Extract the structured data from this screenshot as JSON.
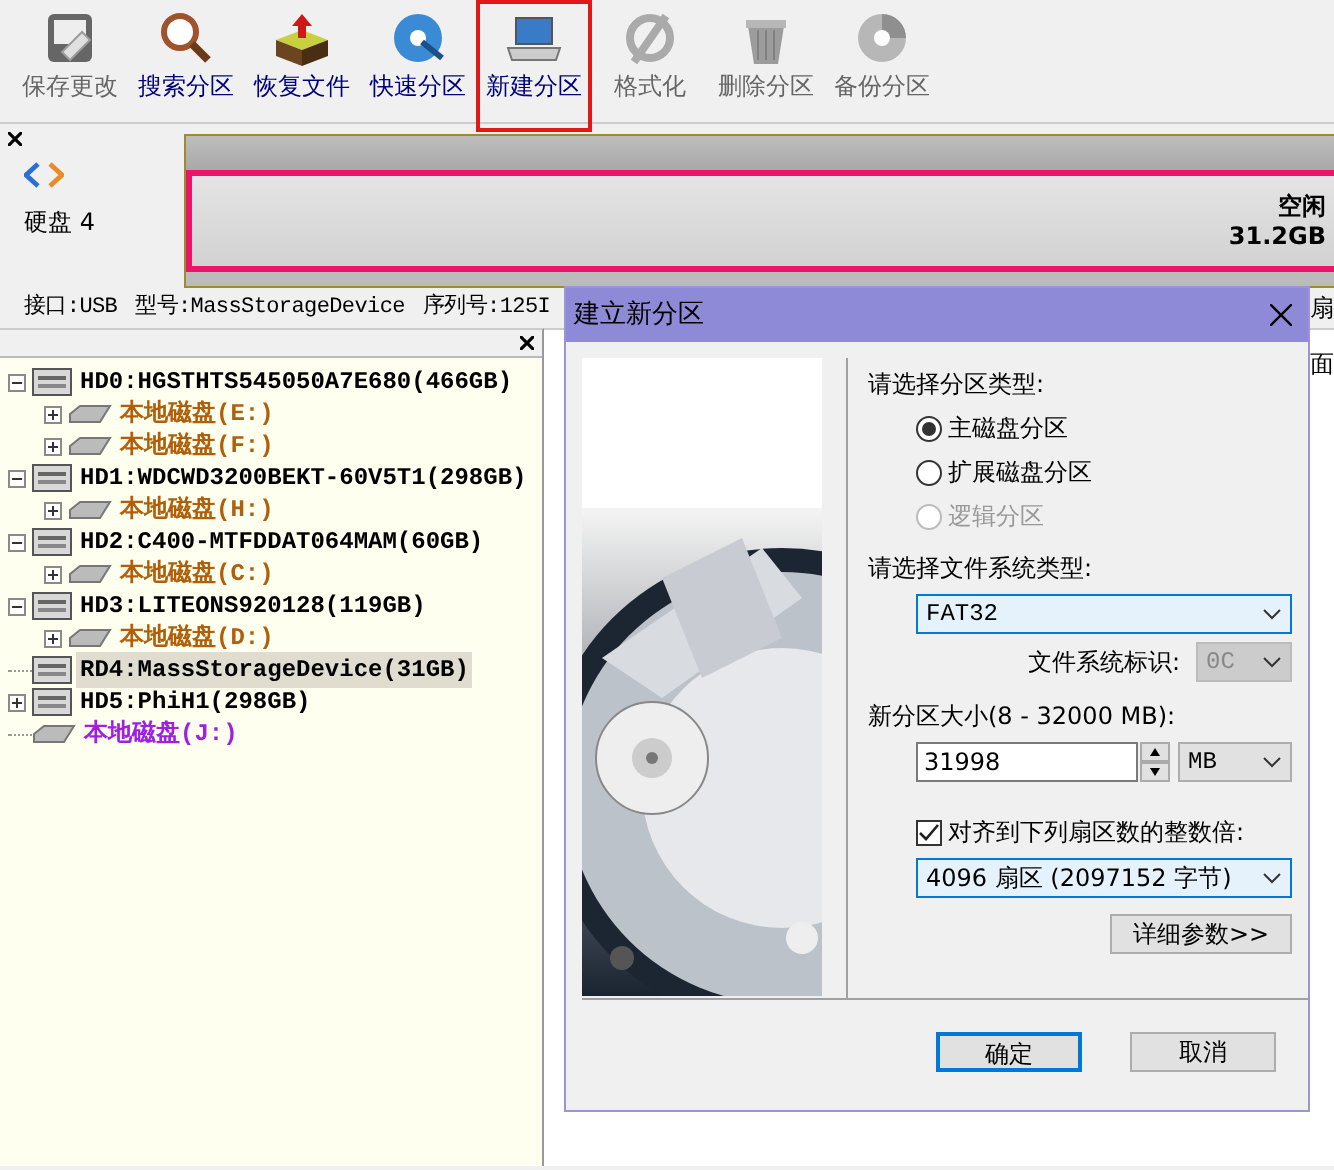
{
  "toolbar": [
    {
      "label": "保存更改",
      "disabled": true,
      "selected": false
    },
    {
      "label": "搜索分区",
      "disabled": false,
      "selected": false
    },
    {
      "label": "恢复文件",
      "disabled": false,
      "selected": false
    },
    {
      "label": "快速分区",
      "disabled": false,
      "selected": false
    },
    {
      "label": "新建分区",
      "disabled": false,
      "selected": true
    },
    {
      "label": "格式化",
      "disabled": true,
      "selected": false
    },
    {
      "label": "删除分区",
      "disabled": true,
      "selected": false
    },
    {
      "label": "备份分区",
      "disabled": true,
      "selected": false
    }
  ],
  "disk_panel": {
    "disk_label": "硬盘 4",
    "free_label": "空闲",
    "free_size": "31.2GB"
  },
  "info_bar": [
    "接口:USB",
    "型号:MassStorageDevice",
    "序列号:125I"
  ],
  "background_texts": [
    "扇",
    "面"
  ],
  "tree": [
    {
      "kind": "disk",
      "label": "HD0:HGSTHTS545050A7E680(466GB)",
      "expanded": true,
      "selected": false,
      "children": [
        {
          "kind": "partition",
          "label": "本地磁盘(E:)",
          "color": "#b0600c",
          "expanded": false,
          "selected": false
        },
        {
          "kind": "partition",
          "label": "本地磁盘(F:)",
          "color": "#b0600c",
          "expanded": false,
          "selected": false
        }
      ]
    },
    {
      "kind": "disk",
      "label": "HD1:WDCWD3200BEKT-60V5T1(298GB)",
      "expanded": true,
      "selected": false,
      "children": [
        {
          "kind": "partition",
          "label": "本地磁盘(H:)",
          "color": "#b0600c",
          "expanded": false,
          "selected": false
        }
      ]
    },
    {
      "kind": "disk",
      "label": "HD2:C400-MTFDDAT064MAM(60GB)",
      "expanded": true,
      "selected": false,
      "children": [
        {
          "kind": "partition",
          "label": "本地磁盘(C:)",
          "color": "#b0600c",
          "expanded": false,
          "selected": false
        }
      ]
    },
    {
      "kind": "disk",
      "label": "HD3:LITEONS920128(119GB)",
      "expanded": true,
      "selected": false,
      "children": [
        {
          "kind": "partition",
          "label": "本地磁盘(D:)",
          "color": "#b0600c",
          "expanded": false,
          "selected": false
        }
      ]
    },
    {
      "kind": "disk",
      "label": "RD4:MassStorageDevice(31GB)",
      "selected": true
    },
    {
      "kind": "disk",
      "label": "HD5:PhiH1(298GB)",
      "expanded": false,
      "selected": false
    },
    {
      "kind": "partition",
      "label": "本地磁盘(J:)",
      "color": "#a020e0",
      "selected": false
    }
  ],
  "dialog": {
    "title": "建立新分区",
    "partition_type_label": "请选择分区类型:",
    "partition_types": [
      {
        "label": "主磁盘分区",
        "selected": true,
        "disabled": false
      },
      {
        "label": "扩展磁盘分区",
        "selected": false,
        "disabled": false
      },
      {
        "label": "逻辑分区",
        "selected": false,
        "disabled": true
      }
    ],
    "fs_label": "请选择文件系统类型:",
    "fs_value": "FAT32",
    "fs_id_label": "文件系统标识:",
    "fs_id_value": "0C",
    "fs_id_disabled": true,
    "size_label": "新分区大小(8 - 32000 MB):",
    "size_value": "31998",
    "size_unit": "MB",
    "align_checked": true,
    "align_label": "对齐到下列扇区数的整数倍:",
    "align_value": "4096 扇区 (2097152 字节)",
    "advanced_button": "详细参数>>",
    "ok_button": "确定",
    "cancel_button": "取消"
  }
}
